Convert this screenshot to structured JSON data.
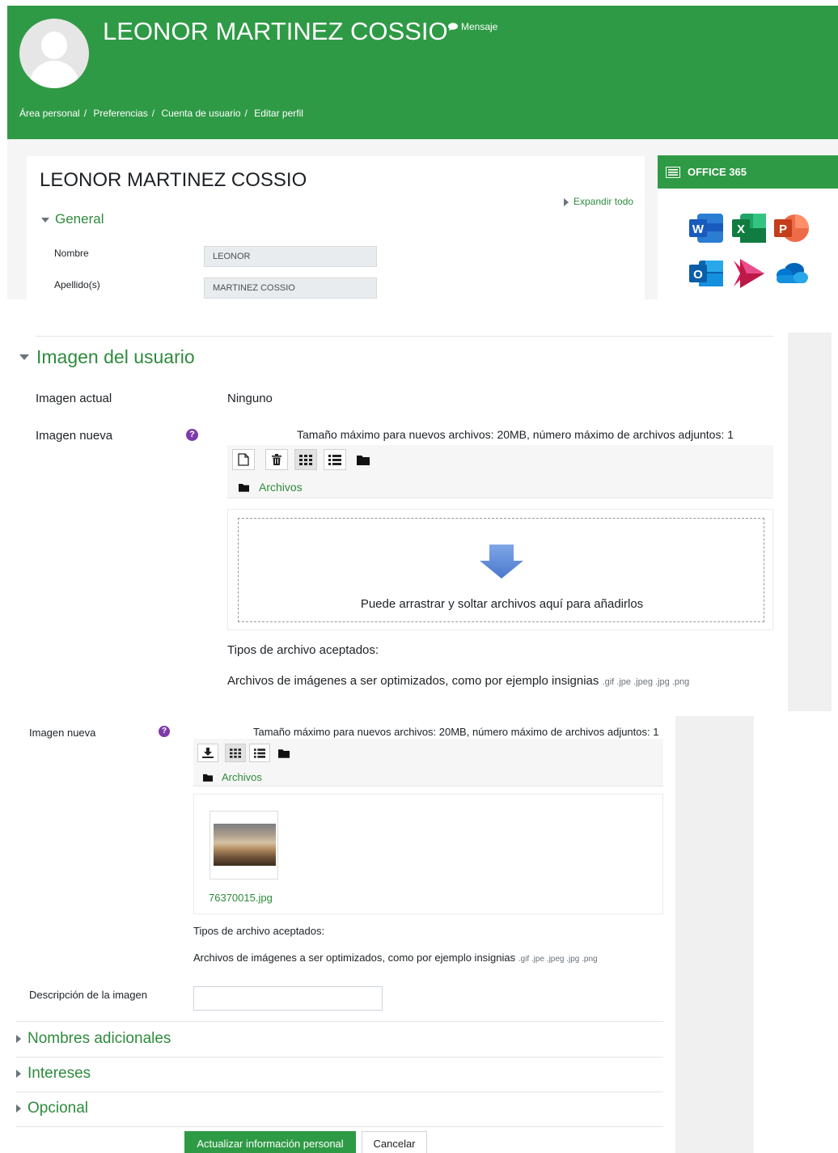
{
  "profile": {
    "name": "LEONOR MARTINEZ COSSIO",
    "message_label": "Mensaje",
    "breadcrumbs": [
      "Área personal",
      "Preferencias",
      "Cuenta de usuario",
      "Editar perfil"
    ]
  },
  "form": {
    "title": "LEONOR MARTINEZ COSSIO",
    "expand_all": "Expandir todo",
    "general_section": "General",
    "fields": {
      "first_name_label": "Nombre",
      "first_name_value": "LEONOR",
      "last_name_label": "Apellido(s)",
      "last_name_value": "MARTINEZ COSSIO"
    }
  },
  "office365": {
    "title": "OFFICE 365",
    "apps": [
      "word-icon",
      "excel-icon",
      "powerpoint-icon",
      "outlook-icon",
      "stream-icon",
      "onedrive-icon"
    ]
  },
  "user_image": {
    "section_title": "Imagen del usuario",
    "current_label": "Imagen actual",
    "current_value": "Ninguno",
    "new_label": "Imagen nueva",
    "limits": "Tamaño máximo para nuevos archivos: 20MB, número máximo de archivos adjuntos: 1",
    "folder": "Archivos",
    "drop_text": "Puede arrastrar y soltar archivos aquí para añadirlos",
    "accepted_label": "Tipos de archivo aceptados:",
    "accepted_desc": "Archivos de imágenes a ser optimizados, como por ejemplo insignias",
    "accepted_exts": ".gif .jpe .jpeg .jpg .png"
  },
  "uploaded": {
    "new_label": "Imagen nueva",
    "limits": "Tamaño máximo para nuevos archivos: 20MB, número máximo de archivos adjuntos: 1",
    "folder": "Archivos",
    "file_name": "76370015.jpg",
    "accepted_label": "Tipos de archivo aceptados:",
    "accepted_desc": "Archivos de imágenes a ser optimizados, como por ejemplo insignias",
    "accepted_exts": ".gif .jpe .jpeg .jpg .png",
    "description_label": "Descripción de la imagen",
    "description_value": ""
  },
  "sections": [
    "Nombres adicionales",
    "Intereses",
    "Opcional"
  ],
  "buttons": {
    "update": "Actualizar información personal",
    "cancel": "Cancelar"
  },
  "colors": {
    "brand_green": "#2f9a45",
    "link_green": "#2e8b3d",
    "help_purple": "#7d3ba8"
  }
}
